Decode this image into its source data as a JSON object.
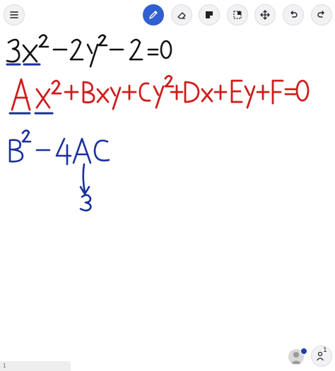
{
  "toolbar": {
    "menu_icon": "hamburger-icon",
    "tools": [
      {
        "name": "pen-tool",
        "icon": "pencil-icon",
        "active": true
      },
      {
        "name": "eraser-tool",
        "icon": "eraser-icon",
        "active": false
      },
      {
        "name": "sticky-note-tool",
        "icon": "sticky-note-icon",
        "active": false
      },
      {
        "name": "select-tool",
        "icon": "selection-icon",
        "active": false
      },
      {
        "name": "move-tool",
        "icon": "move-arrows-icon",
        "active": false
      },
      {
        "name": "undo-button",
        "icon": "undo-icon",
        "active": false
      },
      {
        "name": "redo-button",
        "icon": "redo-icon",
        "active": false
      }
    ]
  },
  "canvas": {
    "ink_colors": {
      "black": "#111111",
      "blue": "#1a2fa0",
      "red": "#d01c1c"
    }
  },
  "footer": {
    "page_number": "1",
    "participants_count": "1"
  }
}
